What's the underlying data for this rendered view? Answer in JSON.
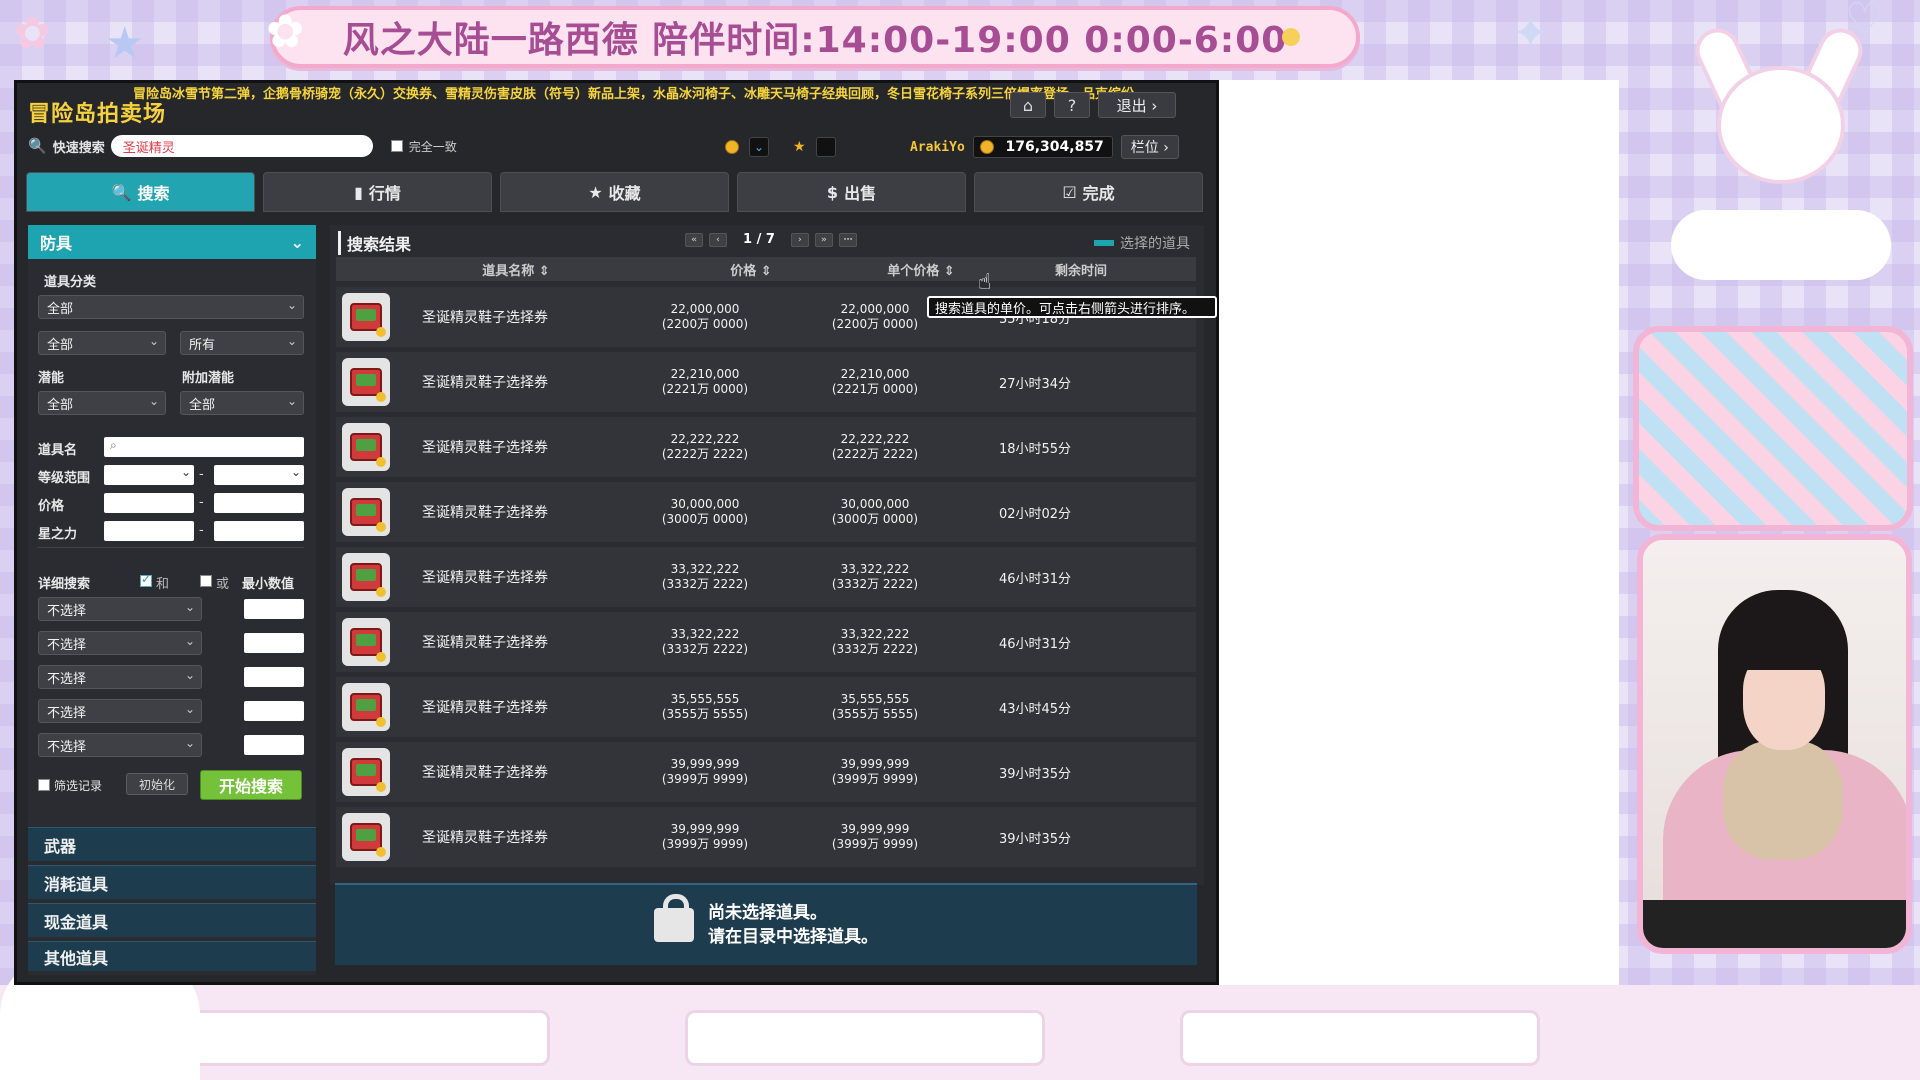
{
  "stream": {
    "banner": "风之大陆一路西德   陪伴时间:14:00-19:00 0:00-6:00"
  },
  "game": {
    "ticker": "冒险岛冰雪节第二弹，企鹅骨桥骑宠（永久）交换券、雪精灵伤害皮肤（符号）新品上架，水晶冰河椅子、冰雕天马椅子经典回顾，冬日雪花椅子系列三倍爆率登场，品克缤纷",
    "title": "冒险岛拍卖场",
    "top_icons": [
      "⌂",
      "?"
    ],
    "logout": "退出 ›",
    "search": {
      "label": "快速搜索",
      "value": "圣诞精灵",
      "exact_match": "完全一致"
    },
    "user": {
      "name": "ArakiYo",
      "meso": "176,304,857",
      "slot": "栏位 ›"
    },
    "tabs": [
      {
        "label": "搜索",
        "icon": "🔍"
      },
      {
        "label": "行情",
        "icon": "▮"
      },
      {
        "label": "收藏",
        "icon": "★"
      },
      {
        "label": "出售",
        "icon": "$"
      },
      {
        "label": "完成",
        "icon": "☑"
      }
    ],
    "sidebar": {
      "category": "防具",
      "item_category_label": "道具分类",
      "sel_all_1": "全部",
      "sel_all_2": "全部",
      "sel_owned": "所有",
      "potential_label": "潜能",
      "bonus_potential_label": "附加潜能",
      "sel_potential": "全部",
      "sel_bonus_potential": "全部",
      "item_name_label": "道具名",
      "level_range_label": "等级范围",
      "price_label": "价格",
      "starforce_label": "星之力",
      "detail_search_label": "详细搜索",
      "and_label": "和",
      "or_label": "或",
      "min_value_label": "最小数值",
      "detail_options": [
        "不选择",
        "不选择",
        "不选择",
        "不选择",
        "不选择"
      ],
      "filter_record": "筛选记录",
      "reset": "初始化",
      "start_search": "开始搜索",
      "categories": [
        "武器",
        "消耗道具",
        "现金道具",
        "其他道具"
      ]
    },
    "results": {
      "title": "搜索结果",
      "page": "1 / 7",
      "selected_legend": "选择的道具",
      "headers": {
        "name": "道具名称 ⇕",
        "price": "价格 ⇕",
        "unit_price": "单个价格 ⇕",
        "time": "剩余时间"
      },
      "tooltip": "搜索道具的单价。可点击右侧箭头进行排序。",
      "rows": [
        {
          "name": "圣诞精灵鞋子选择券",
          "price": "22,000,000",
          "price_sub": "(2200万 0000)",
          "unit": "22,000,000",
          "unit_sub": "(2200万 0000)",
          "time": "35小时18分"
        },
        {
          "name": "圣诞精灵鞋子选择券",
          "price": "22,210,000",
          "price_sub": "(2221万 0000)",
          "unit": "22,210,000",
          "unit_sub": "(2221万 0000)",
          "time": "27小时34分"
        },
        {
          "name": "圣诞精灵鞋子选择券",
          "price": "22,222,222",
          "price_sub": "(2222万 2222)",
          "unit": "22,222,222",
          "unit_sub": "(2222万 2222)",
          "time": "18小时55分"
        },
        {
          "name": "圣诞精灵鞋子选择券",
          "price": "30,000,000",
          "price_sub": "(3000万 0000)",
          "unit": "30,000,000",
          "unit_sub": "(3000万 0000)",
          "time": "02小时02分"
        },
        {
          "name": "圣诞精灵鞋子选择券",
          "price": "33,322,222",
          "price_sub": "(3332万 2222)",
          "unit": "33,322,222",
          "unit_sub": "(3332万 2222)",
          "time": "46小时31分"
        },
        {
          "name": "圣诞精灵鞋子选择券",
          "price": "33,322,222",
          "price_sub": "(3332万 2222)",
          "unit": "33,322,222",
          "unit_sub": "(3332万 2222)",
          "time": "46小时31分"
        },
        {
          "name": "圣诞精灵鞋子选择券",
          "price": "35,555,555",
          "price_sub": "(3555万 5555)",
          "unit": "35,555,555",
          "unit_sub": "(3555万 5555)",
          "time": "43小时45分"
        },
        {
          "name": "圣诞精灵鞋子选择券",
          "price": "39,999,999",
          "price_sub": "(3999万 9999)",
          "unit": "39,999,999",
          "unit_sub": "(3999万 9999)",
          "time": "39小时35分"
        },
        {
          "name": "圣诞精灵鞋子选择券",
          "price": "39,999,999",
          "price_sub": "(3999万 9999)",
          "unit": "39,999,999",
          "unit_sub": "(3999万 9999)",
          "time": "39小时35分"
        }
      ],
      "empty_line1": "尚未选择道具。",
      "empty_line2": "请在目录中选择道具。"
    }
  }
}
